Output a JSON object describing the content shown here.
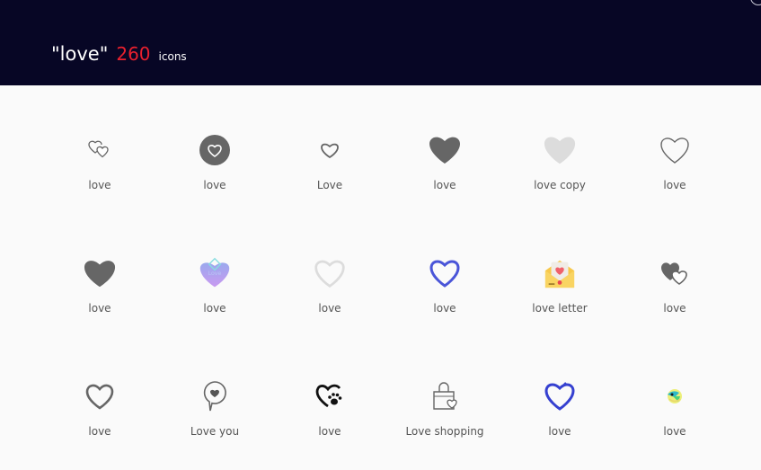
{
  "header": {
    "query": "\"love\"",
    "count": "260",
    "suffix": "icons"
  },
  "colors": {
    "header_bg": "#070625",
    "count_red": "#e8202e",
    "icon_gray": "#666666",
    "icon_light_gray": "#dddddd",
    "icon_blue": "#4a55d8"
  },
  "icons": [
    {
      "label": "love",
      "icon": "double-heart-outline-icon"
    },
    {
      "label": "love",
      "icon": "heart-in-circle-icon"
    },
    {
      "label": "Love",
      "icon": "heart-outline-small-icon"
    },
    {
      "label": "love",
      "icon": "heart-filled-icon"
    },
    {
      "label": "love copy",
      "icon": "heart-filled-light-icon"
    },
    {
      "label": "love",
      "icon": "heart-outline-thin-icon"
    },
    {
      "label": "love",
      "icon": "heart-filled-icon"
    },
    {
      "label": "love",
      "icon": "heart-purple-gradient-icon"
    },
    {
      "label": "love",
      "icon": "heart-outline-light-icon"
    },
    {
      "label": "love",
      "icon": "heart-outline-blue-icon"
    },
    {
      "label": "love letter",
      "icon": "love-letter-envelope-icon"
    },
    {
      "label": "love",
      "icon": "double-heart-filled-icon"
    },
    {
      "label": "love",
      "icon": "heart-outline-bold-icon"
    },
    {
      "label": "Love you",
      "icon": "heart-speech-bubble-icon"
    },
    {
      "label": "love",
      "icon": "heart-paw-icon"
    },
    {
      "label": "Love shopping",
      "icon": "shopping-bag-heart-icon"
    },
    {
      "label": "love",
      "icon": "heart-outline-blue-brush-icon"
    },
    {
      "label": "love",
      "icon": "colorful-sticker-icon"
    }
  ]
}
